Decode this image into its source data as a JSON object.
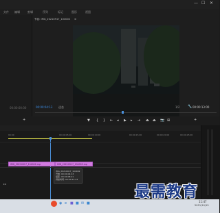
{
  "menu": {
    "items": [
      "文件",
      "编辑",
      "剪辑",
      "序列",
      "标记",
      "图形",
      "视图"
    ],
    "win_controls": [
      "—",
      "☐",
      "✕"
    ]
  },
  "program": {
    "tab_label": "节目: IMG_20210917_104002",
    "menu_glyph": "≡"
  },
  "transport": {
    "left_timecode": "00:00:00:00",
    "current_timecode": "00:00:04:13",
    "fit_label": "适合",
    "quality_label": "1/2",
    "duration_timecode": "00:00:13:00"
  },
  "timeline": {
    "ruler_labels": [
      "00:00",
      "00:00:05:00",
      "00:00:10:00",
      "00:00:15:00",
      "00:00:20:00",
      "00:00:25:00"
    ],
    "clips": [
      {
        "label": "IMG_20210917_104002.mp"
      },
      {
        "label": "IMG_20210917_104002.mp"
      }
    ],
    "tooltip_lines": [
      "IMG_20210917_104002",
      "开始: 00:00:04:13",
      "结束: 00:00:08:21",
      "持续时间: 00:00:13:23"
    ]
  },
  "watermark": {
    "text": "最需教育"
  },
  "taskbar": {
    "time": "11:47",
    "date": "2021/10/15"
  },
  "colors": {
    "accent": "#2d8ceb",
    "clip": "#d27be0",
    "playhead": "#4a8fd9",
    "audio_line": "#d8d84a"
  }
}
